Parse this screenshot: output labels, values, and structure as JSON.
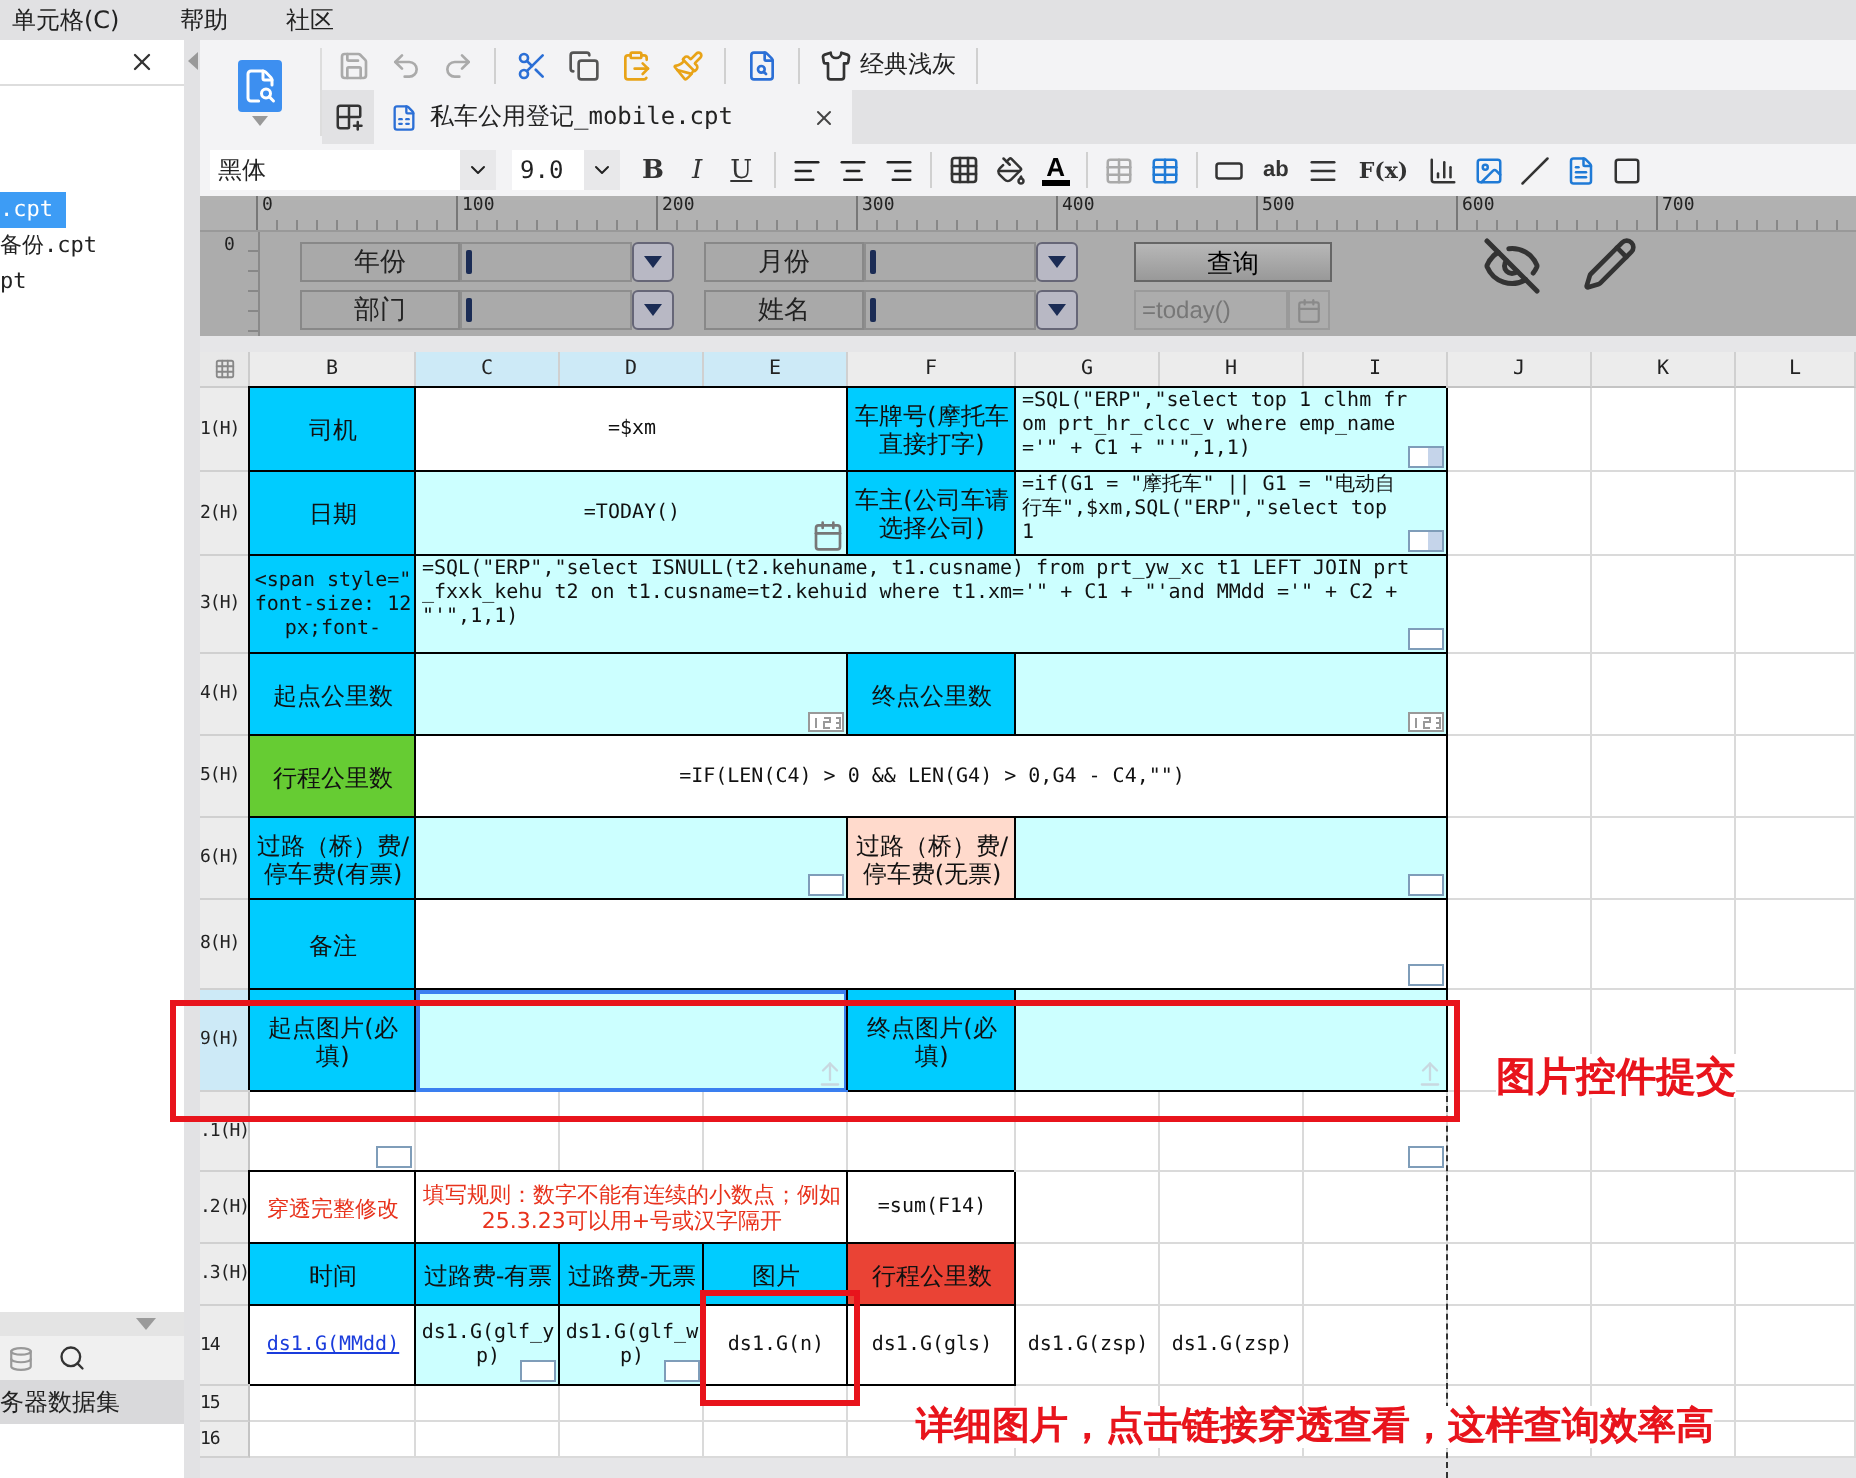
{
  "menu_bar": [
    "单元格(C)",
    "帮助",
    "社区"
  ],
  "left_panel": {
    "files": [
      {
        "label": ".cpt",
        "selected": true
      },
      {
        "label": "备份.cpt",
        "selected": false
      },
      {
        "label": "pt",
        "selected": false
      }
    ],
    "dataset_tab": "务器数据集"
  },
  "toolbar": {
    "theme_label": "经典浅灰"
  },
  "tab": {
    "title": "私车公用登记_mobile.cpt",
    "selected": true
  },
  "format_bar": {
    "font": "黑体",
    "size": "9.0",
    "style_buttons": [
      "B",
      "I",
      "U"
    ],
    "font_color_label": "A",
    "text_tool": "ab",
    "formula_tool": "F(x)"
  },
  "ruler": {
    "ticks": [
      "0",
      "100",
      "200",
      "300",
      "400",
      "500",
      "600",
      "700"
    ],
    "vertical_origin": "0"
  },
  "parameters": {
    "fields": [
      {
        "label": "年份"
      },
      {
        "label": "月份"
      },
      {
        "label": "部门"
      },
      {
        "label": "姓名"
      }
    ],
    "button": "查询",
    "date_value": "=today()"
  },
  "sheet": {
    "columns": [
      {
        "label": "B",
        "selected": false
      },
      {
        "label": "C",
        "selected": true
      },
      {
        "label": "D",
        "selected": true
      },
      {
        "label": "E",
        "selected": true
      },
      {
        "label": "F",
        "selected": false
      },
      {
        "label": "G",
        "selected": false
      },
      {
        "label": "H",
        "selected": false
      },
      {
        "label": "I",
        "selected": false
      },
      {
        "label": "J",
        "selected": false
      },
      {
        "label": "K",
        "selected": false
      },
      {
        "label": "L",
        "selected": false
      }
    ],
    "rows": [
      {
        "header": "1(H)",
        "selected": false,
        "cells": [
          {
            "text": "司机",
            "kind": "header",
            "selected": false
          },
          {
            "text": "=$xm",
            "kind": "plain",
            "selected": false
          },
          {
            "text": "车牌号(摩托车直接打字)",
            "kind": "header",
            "selected": false
          },
          {
            "text": "=SQL(\"ERP\",\"select top 1 clhm from prt_hr_clcc_v where emp_name='\" + C1 + \"'\",1,1)",
            "kind": "code",
            "widget": {
              "kind": "combo"
            },
            "selected": false
          }
        ]
      },
      {
        "header": "2(H)",
        "selected": false,
        "cells": [
          {
            "text": "日期",
            "kind": "header",
            "selected": false
          },
          {
            "text": "=TODAY()",
            "kind": "input",
            "widget": {
              "kind": "date"
            },
            "selected": false
          },
          {
            "text": "车主(公司车请选择公司)",
            "kind": "header",
            "selected": false
          },
          {
            "text": "=if(G1 = \"摩托车\" || G1 = \"电动自行车\",$xm,SQL(\"ERP\",\"select top 1",
            "kind": "code",
            "widget": {
              "kind": "combo"
            },
            "selected": false
          }
        ]
      },
      {
        "header": "3(H)",
        "selected": false,
        "cells": [
          {
            "text": "<span style=\" font-size: 12px;font-",
            "kind": "header-code",
            "selected": false
          },
          {
            "text": "=SQL(\"ERP\",\"select ISNULL(t2.kehuname, t1.cusname) from prt_yw_xc t1 LEFT JOIN prt_fxxk_kehu t2 on t1.cusname=t2.kehuid  where t1.xm='\" + C1 + \"'and MMdd ='\" + C2 + \"'\",1,1)",
            "kind": "code",
            "widget": {
              "kind": "text"
            },
            "selected": false
          }
        ]
      },
      {
        "header": "4(H)",
        "selected": false,
        "cells": [
          {
            "text": "起点公里数",
            "kind": "header",
            "selected": false
          },
          {
            "kind": "input",
            "widget": {
              "kind": "number"
            },
            "selected": false
          },
          {
            "text": "终点公里数",
            "kind": "header",
            "selected": false
          },
          {
            "kind": "input",
            "widget": {
              "kind": "number"
            },
            "selected": false
          }
        ]
      },
      {
        "header": "5(H)",
        "selected": false,
        "cells": [
          {
            "text": "行程公里数",
            "kind": "highlight",
            "selected": false
          },
          {
            "text": "=IF(LEN(C4) > 0 && LEN(G4) > 0,G4 - C4,\"\")",
            "kind": "plain",
            "selected": false
          }
        ]
      },
      {
        "header": "6(H)",
        "selected": false,
        "cells": [
          {
            "text": "过路（桥）费/停车费(有票)",
            "kind": "header",
            "selected": false
          },
          {
            "kind": "input",
            "widget": {
              "kind": "text"
            },
            "selected": false
          },
          {
            "text": "过路（桥）费/停车费(无票)",
            "kind": "alt",
            "selected": false
          },
          {
            "kind": "input",
            "widget": {
              "kind": "text"
            },
            "selected": false
          }
        ]
      },
      {
        "header": "8(H)",
        "selected": false,
        "cells": [
          {
            "text": "备注",
            "kind": "header",
            "selected": false
          },
          {
            "kind": "plain",
            "widget": {
              "kind": "text"
            },
            "selected": false
          }
        ]
      },
      {
        "header": "9(H)",
        "selected": true,
        "cells": [
          {
            "text": "起点图片(必填)",
            "kind": "header",
            "selected": false
          },
          {
            "kind": "input",
            "widget": {
              "kind": "upload"
            },
            "selected": true
          },
          {
            "text": "终点图片(必填)",
            "kind": "header",
            "selected": false
          },
          {
            "kind": "input",
            "widget": {
              "kind": "upload"
            },
            "selected": false
          }
        ]
      },
      {
        "header": ".1(H)",
        "selected": false,
        "cells": [
          {
            "kind": "blank",
            "widget": {
              "kind": "text"
            },
            "selected": false
          },
          {
            "kind": "blank",
            "widget": {
              "kind": "text"
            },
            "selected": false
          }
        ]
      },
      {
        "header": ".2(H)",
        "selected": false,
        "cells": [
          {
            "text": "穿透完整修改",
            "kind": "rule",
            "selected": false
          },
          {
            "text": "填写规则：数字不能有连续的小数点；例如25.3.23可以用+号或汉字隔开",
            "kind": "rule",
            "selected": false
          },
          {
            "text": "=sum(F14)",
            "kind": "plain",
            "selected": false
          }
        ]
      },
      {
        "header": ".3(H)",
        "selected": false,
        "cells": [
          {
            "text": "时间",
            "kind": "header",
            "selected": false
          },
          {
            "text": "过路费-有票",
            "kind": "header",
            "selected": false
          },
          {
            "text": "过路费-无票",
            "kind": "header",
            "selected": false
          },
          {
            "text": "图片",
            "kind": "header",
            "selected": false
          },
          {
            "text": "行程公里数",
            "kind": "accent",
            "selected": false
          }
        ]
      },
      {
        "header": "14",
        "selected": false,
        "cells": [
          {
            "text": "ds1.G(MMdd)",
            "kind": "link",
            "selected": false
          },
          {
            "text": "ds1.G(glf_yp)",
            "kind": "input",
            "widget": {
              "kind": "text"
            },
            "selected": false
          },
          {
            "text": "ds1.G(glf_wp)",
            "kind": "input",
            "widget": {
              "kind": "text"
            },
            "selected": false
          },
          {
            "text": "ds1.G(n)",
            "kind": "plain",
            "selected": false
          },
          {
            "text": "ds1.G(gls)",
            "kind": "plain",
            "selected": false
          },
          {
            "text": "ds1.G(zsp)",
            "kind": "loose",
            "selected": false
          },
          {
            "text": "ds1.G(zsp)",
            "kind": "loose",
            "selected": false
          }
        ]
      },
      {
        "header": "15",
        "selected": false,
        "cells": []
      },
      {
        "header": "16",
        "selected": false,
        "cells": []
      }
    ]
  },
  "annotations": [
    {
      "text": "图片控件提交"
    },
    {
      "text": "详细图片，点击链接穿透查看，这样查询效率高"
    }
  ]
}
